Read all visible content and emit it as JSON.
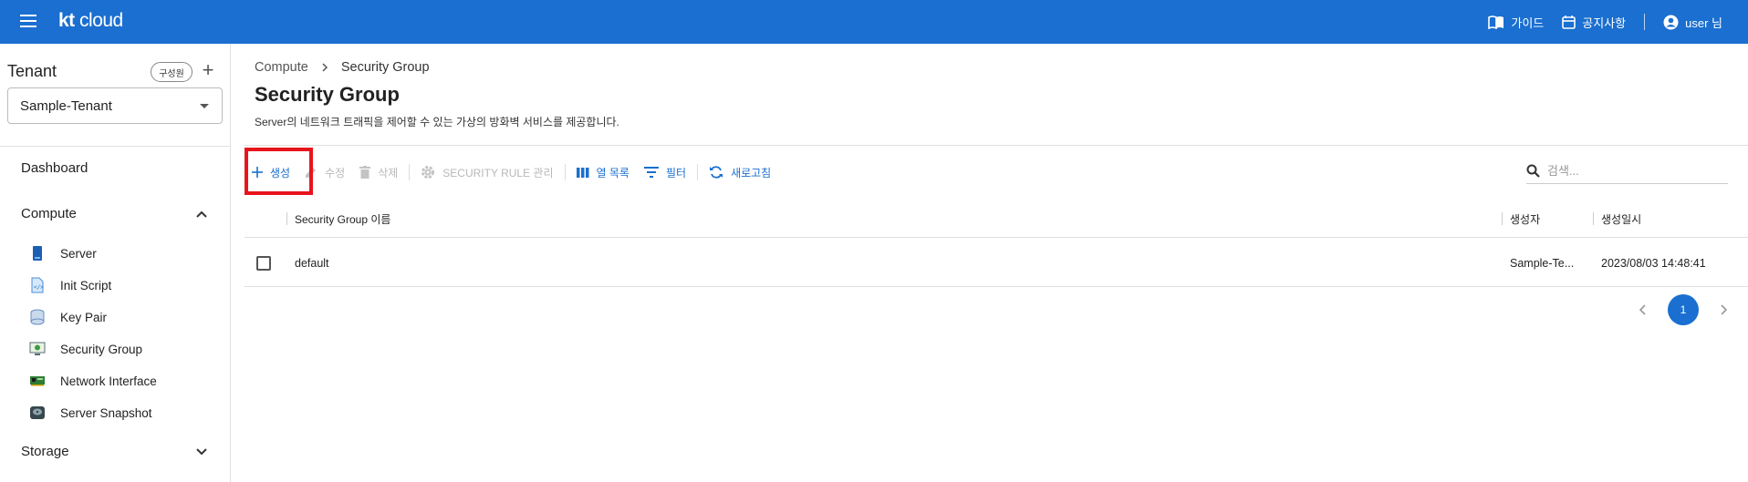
{
  "header": {
    "logo_kt": "kt",
    "logo_cloud": "cloud",
    "guide": "가이드",
    "notice": "공지사항",
    "user": "user 님"
  },
  "sidebar": {
    "tenant_title": "Tenant",
    "member_button": "구성원",
    "tenant_selected": "Sample-Tenant",
    "dashboard": "Dashboard",
    "compute": "Compute",
    "compute_items": [
      {
        "label": "Server",
        "icon": "server-icon"
      },
      {
        "label": "Init Script",
        "icon": "script-file-icon"
      },
      {
        "label": "Key Pair",
        "icon": "key-pair-icon"
      },
      {
        "label": "Security Group",
        "icon": "security-monitor-icon"
      },
      {
        "label": "Network Interface",
        "icon": "network-card-icon"
      },
      {
        "label": "Server Snapshot",
        "icon": "snapshot-disk-icon"
      }
    ],
    "storage": "Storage"
  },
  "breadcrumb": {
    "parent": "Compute",
    "current": "Security Group"
  },
  "page": {
    "title": "Security Group",
    "description": "Server의 네트워크 트래픽을 제어할 수 있는 가상의 방화벽 서비스를 제공합니다."
  },
  "toolbar": {
    "create": "생성",
    "edit": "수정",
    "delete": "삭제",
    "security_rule": "SECURITY RULE 관리",
    "columns": "열 목록",
    "filter": "필터",
    "refresh": "새로고침",
    "search_placeholder": "검색..."
  },
  "table": {
    "headers": {
      "name": "Security Group 이름",
      "creator": "생성자",
      "created_at": "생성일시"
    },
    "rows": [
      {
        "name": "default",
        "creator": "Sample-Te...",
        "created_at": "2023/08/03 14:48:41"
      }
    ]
  },
  "pagination": {
    "current_page": "1"
  },
  "colors": {
    "brand": "#1a6fd0",
    "highlight": "#e8141b"
  }
}
